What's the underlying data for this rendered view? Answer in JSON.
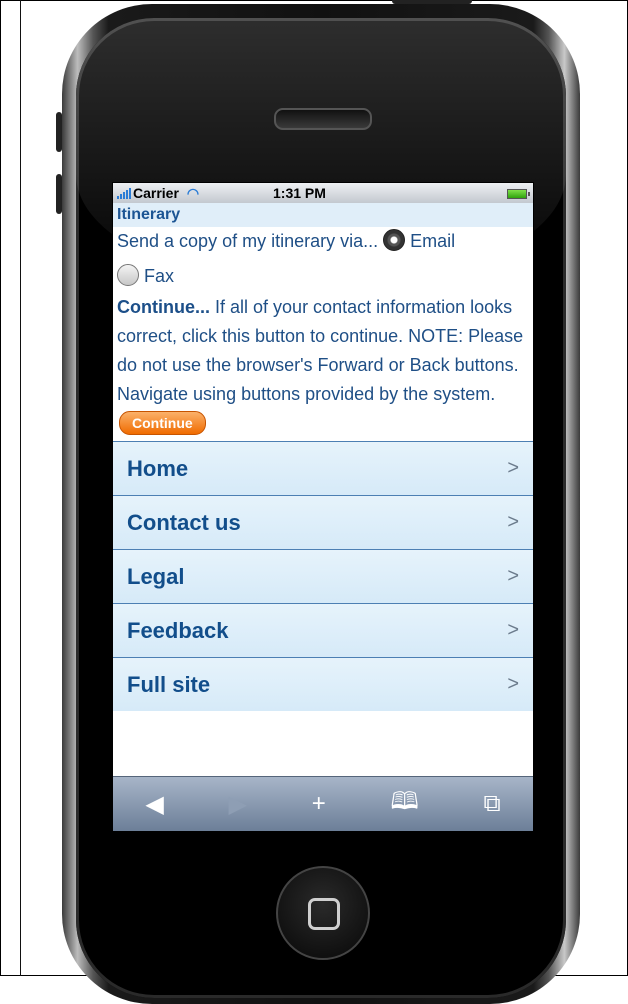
{
  "status": {
    "carrier": "Carrier",
    "time": "1:31 PM"
  },
  "section": {
    "title": "Itinerary"
  },
  "send": {
    "prefix": "Send a copy of my itinerary via...",
    "email": "Email",
    "fax": "Fax"
  },
  "continue_text": {
    "bold": "Continue...",
    "body": "If all of your contact information looks correct, click this button to continue. NOTE: Please do not use the browser's Forward or Back buttons. Navigate using buttons provided by the system."
  },
  "continue_button": "Continue",
  "nav": [
    {
      "label": "Home",
      "chevron": ">"
    },
    {
      "label": "Contact us",
      "chevron": ">"
    },
    {
      "label": "Legal",
      "chevron": ">"
    },
    {
      "label": "Feedback",
      "chevron": ">"
    },
    {
      "label": "Full site",
      "chevron": ">"
    }
  ],
  "toolbar": {
    "back": "◀",
    "forward": "▶",
    "add": "+",
    "bookmarks": "🕮",
    "pages": "⧉"
  }
}
